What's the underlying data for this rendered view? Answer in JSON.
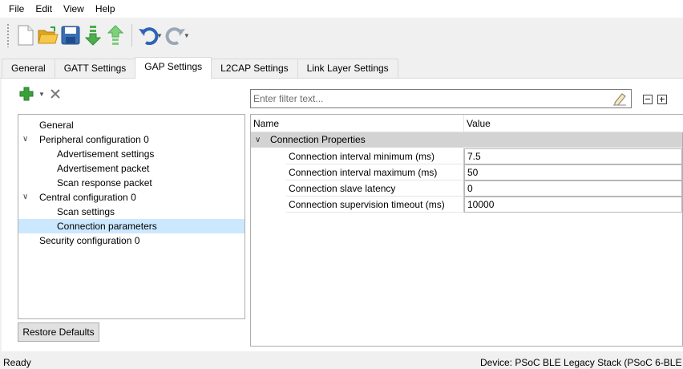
{
  "menu": {
    "items": [
      "File",
      "Edit",
      "View",
      "Help"
    ]
  },
  "toolbar": {
    "icons": [
      "new-file-icon",
      "open-folder-icon",
      "save-icon",
      "import-arrow-icon",
      "export-arrow-icon",
      "undo-icon",
      "redo-icon"
    ]
  },
  "tabs": [
    {
      "label": "General",
      "active": false
    },
    {
      "label": "GATT Settings",
      "active": false
    },
    {
      "label": "GAP Settings",
      "active": true
    },
    {
      "label": "L2CAP Settings",
      "active": false
    },
    {
      "label": "Link Layer Settings",
      "active": false
    }
  ],
  "tree": {
    "items": [
      {
        "label": "General",
        "level": 0,
        "expandable": false,
        "selected": false
      },
      {
        "label": "Peripheral configuration 0",
        "level": 0,
        "expandable": true,
        "selected": false
      },
      {
        "label": "Advertisement settings",
        "level": 1,
        "expandable": false,
        "selected": false
      },
      {
        "label": "Advertisement packet",
        "level": 1,
        "expandable": false,
        "selected": false
      },
      {
        "label": "Scan response packet",
        "level": 1,
        "expandable": false,
        "selected": false
      },
      {
        "label": "Central configuration 0",
        "level": 0,
        "expandable": true,
        "selected": false
      },
      {
        "label": "Scan settings",
        "level": 1,
        "expandable": false,
        "selected": false
      },
      {
        "label": "Connection parameters",
        "level": 1,
        "expandable": false,
        "selected": true
      },
      {
        "label": "Security configuration 0",
        "level": 0,
        "expandable": false,
        "selected": false
      }
    ]
  },
  "restore_button": "Restore Defaults",
  "filter": {
    "placeholder": "Enter filter text..."
  },
  "grid": {
    "header_name": "Name",
    "header_value": "Value",
    "group": "Connection Properties",
    "rows": [
      {
        "name": "Connection interval minimum (ms)",
        "value": "7.5"
      },
      {
        "name": "Connection interval maximum (ms)",
        "value": "50"
      },
      {
        "name": "Connection slave latency",
        "value": "0"
      },
      {
        "name": "Connection supervision timeout (ms)",
        "value": "10000"
      }
    ]
  },
  "status": {
    "left": "Ready",
    "right": "Device: PSoC BLE Legacy Stack (PSoC 6-BLE"
  },
  "colors": {
    "accent_green": "#3aa13a",
    "selection": "#cce8ff",
    "group_row": "#d3d3d3"
  }
}
